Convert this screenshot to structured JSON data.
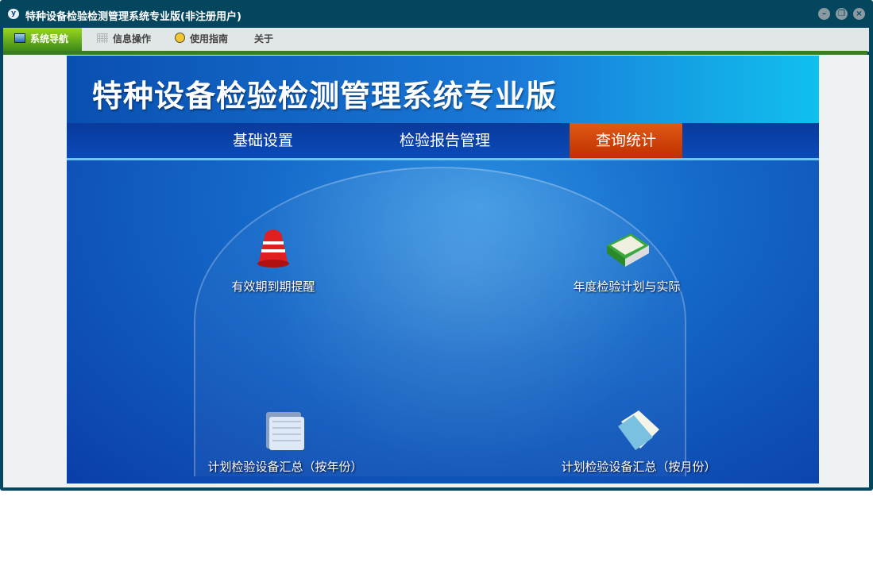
{
  "window": {
    "title": "特种设备检验检测管理系统专业版(非注册用户)",
    "app_icon": "y"
  },
  "menu": [
    {
      "label": "系统导航",
      "icon": "monitor-icon"
    },
    {
      "label": "信息操作",
      "icon": "grid-icon"
    },
    {
      "label": "使用指南",
      "icon": "help-icon"
    },
    {
      "label": "关于"
    }
  ],
  "banner": {
    "title": "特种设备检验检测管理系统专业版"
  },
  "nav": [
    {
      "label": "基础设置"
    },
    {
      "label": "检验报告管理"
    },
    {
      "label": "查询统计",
      "active": true
    }
  ],
  "tiles": [
    {
      "label": "有效期到期提醒",
      "icon": "bell-icon"
    },
    {
      "label": "年度检验计划与实际",
      "icon": "book-icon"
    },
    {
      "label": "计划检验设备汇总（按年份）",
      "icon": "folder-icon"
    },
    {
      "label": "计划检验设备汇总（按月份）",
      "icon": "document-icon"
    }
  ],
  "colors": {
    "frame": "#04465e",
    "active_nav": "#c83a06",
    "menu_green": "#3a7d1e"
  }
}
